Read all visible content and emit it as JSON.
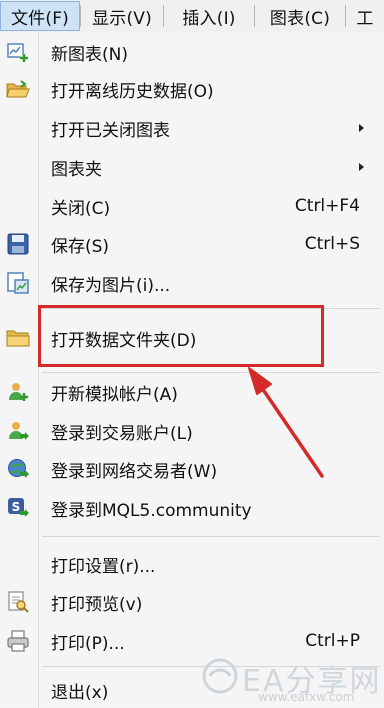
{
  "menubar": {
    "items": [
      {
        "label": "文件(F)"
      },
      {
        "label": "显示(V)"
      },
      {
        "label": "插入(I)"
      },
      {
        "label": "图表(C)"
      },
      {
        "label": "工"
      }
    ]
  },
  "menu": {
    "items": [
      {
        "label": "新图表(N)",
        "icon": "new-chart-icon"
      },
      {
        "label": "打开离线历史数据(O)",
        "icon": "open-folder-icon"
      },
      {
        "label": "打开已关闭图表",
        "submenu": true
      },
      {
        "label": "图表夹",
        "submenu": true
      },
      {
        "label": "关闭(C)",
        "shortcut": "Ctrl+F4"
      },
      {
        "label": "保存(S)",
        "shortcut": "Ctrl+S",
        "icon": "save-icon"
      },
      {
        "label": "保存为图片(i)...",
        "icon": "save-picture-icon"
      },
      {
        "label": "打开数据文件夹(D)",
        "icon": "folder-icon",
        "highlighted": true
      },
      {
        "label": "开新模拟帐户(A)",
        "icon": "new-account-icon"
      },
      {
        "label": "登录到交易账户(L)",
        "icon": "login-account-icon"
      },
      {
        "label": "登录到网络交易者(W)",
        "icon": "web-trader-icon"
      },
      {
        "label": "登录到MQL5.community",
        "icon": "mql5-icon"
      },
      {
        "label": "打印设置(r)...",
        "icon": ""
      },
      {
        "label": "打印预览(v)",
        "icon": "print-preview-icon"
      },
      {
        "label": "打印(P)...",
        "shortcut": "Ctrl+P",
        "icon": "printer-icon"
      },
      {
        "label": "退出(x)"
      }
    ]
  },
  "watermark": {
    "text": "EA分享网",
    "url": "www.eafxw.com"
  },
  "colors": {
    "annotation_red": "#d42a2a",
    "menu_background": "#f5f5f5"
  }
}
